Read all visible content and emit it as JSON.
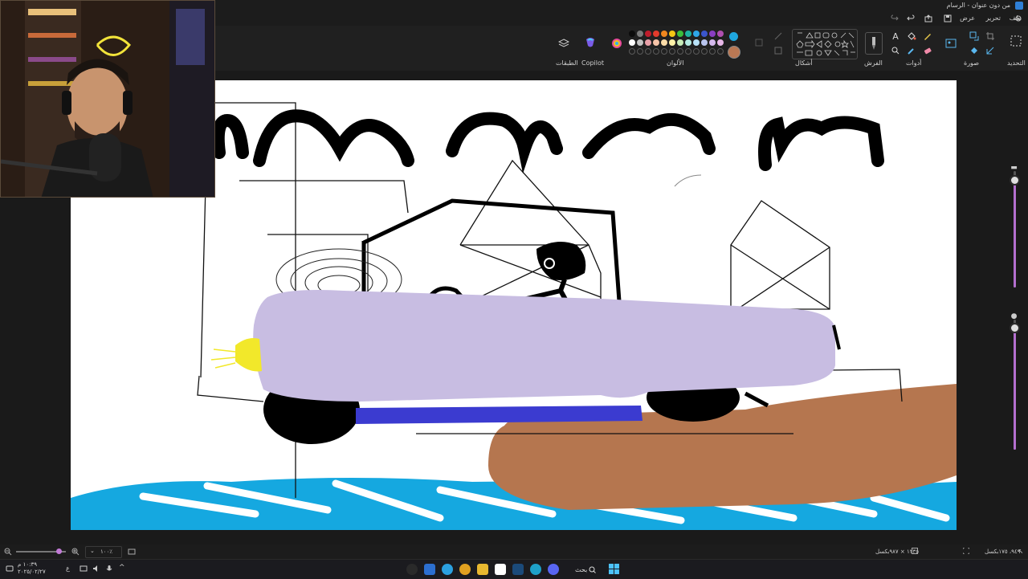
{
  "window": {
    "title": "من دون عنوان - الرسام"
  },
  "menu": {
    "file": "ملف",
    "edit": "تحرير",
    "view": "عرض"
  },
  "ribbon": {
    "groups": {
      "selection": "التحديد",
      "image": "صورة",
      "tools": "أدوات",
      "brushes": "الفرش",
      "shapes": "أشكال",
      "colors": "الألوان",
      "copilot": "Copilot",
      "layers": "الطبقات"
    },
    "palette_row1": [
      "#0b0b0b",
      "#7a7a7a",
      "#c01d2c",
      "#e23b2c",
      "#f0871f",
      "#f2c515",
      "#3bbd3b",
      "#1eb3a0",
      "#2ea6e8",
      "#3b55cc",
      "#8a3ec1",
      "#b04fb0"
    ],
    "palette_row2": [
      "#ffffff",
      "#c3c3c3",
      "#e8a0a8",
      "#f6c3a8",
      "#fbdca8",
      "#fdf2a8",
      "#c7ecb8",
      "#b4ebe3",
      "#b8e2f8",
      "#b9c4ee",
      "#d4b8ec",
      "#e8b8e8"
    ],
    "primary_color": "#1fa6de",
    "secondary_color": "#b97854"
  },
  "status": {
    "canvas_size": "١٢٣٥ × ٩٨٧بكسل",
    "cursor_pos": "٩٤٩، ١٧٥بكسل",
    "zoom": "١٠٠٪"
  },
  "taskbar": {
    "search_label": "بحث",
    "time": "١٠:٣٩ م",
    "date": "٢٠٢٥/٠٢/٢٧"
  }
}
